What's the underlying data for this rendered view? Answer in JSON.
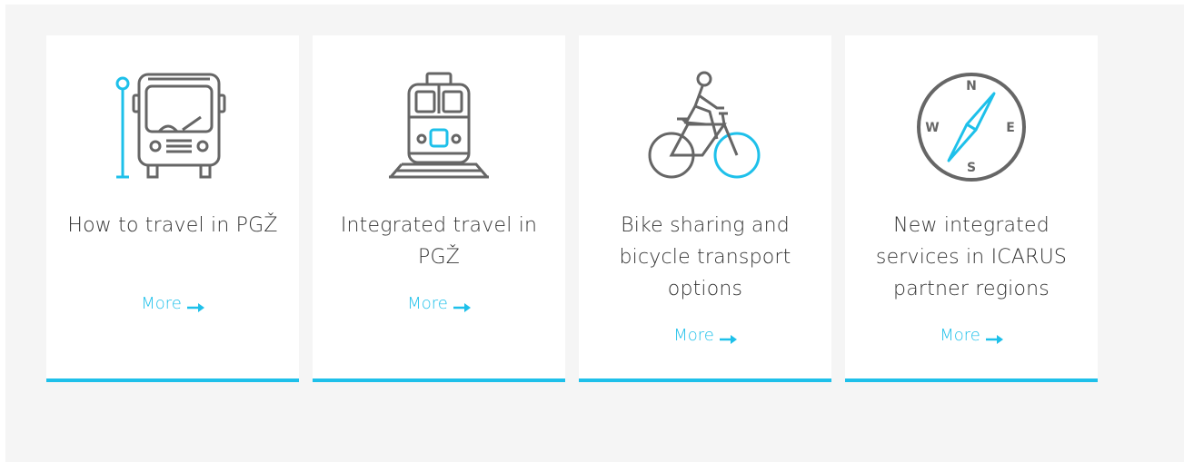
{
  "colors": {
    "accent": "#1ec0ea",
    "icon_gray": "#666666",
    "text": "#333333",
    "background": "#f5f5f5"
  },
  "cards": [
    {
      "icon": "bus-stop-icon",
      "title": "How to travel in PGŽ",
      "link_label": "More"
    },
    {
      "icon": "train-icon",
      "title": "Integrated travel in PGŽ",
      "link_label": "More"
    },
    {
      "icon": "bicycle-icon",
      "title": "Bike sharing and bicycle transport options",
      "link_label": "More"
    },
    {
      "icon": "compass-icon",
      "title": "New integrated services in ICARUS partner regions",
      "link_label": "More"
    }
  ],
  "compass": {
    "n": "N",
    "e": "E",
    "s": "S",
    "w": "W"
  }
}
